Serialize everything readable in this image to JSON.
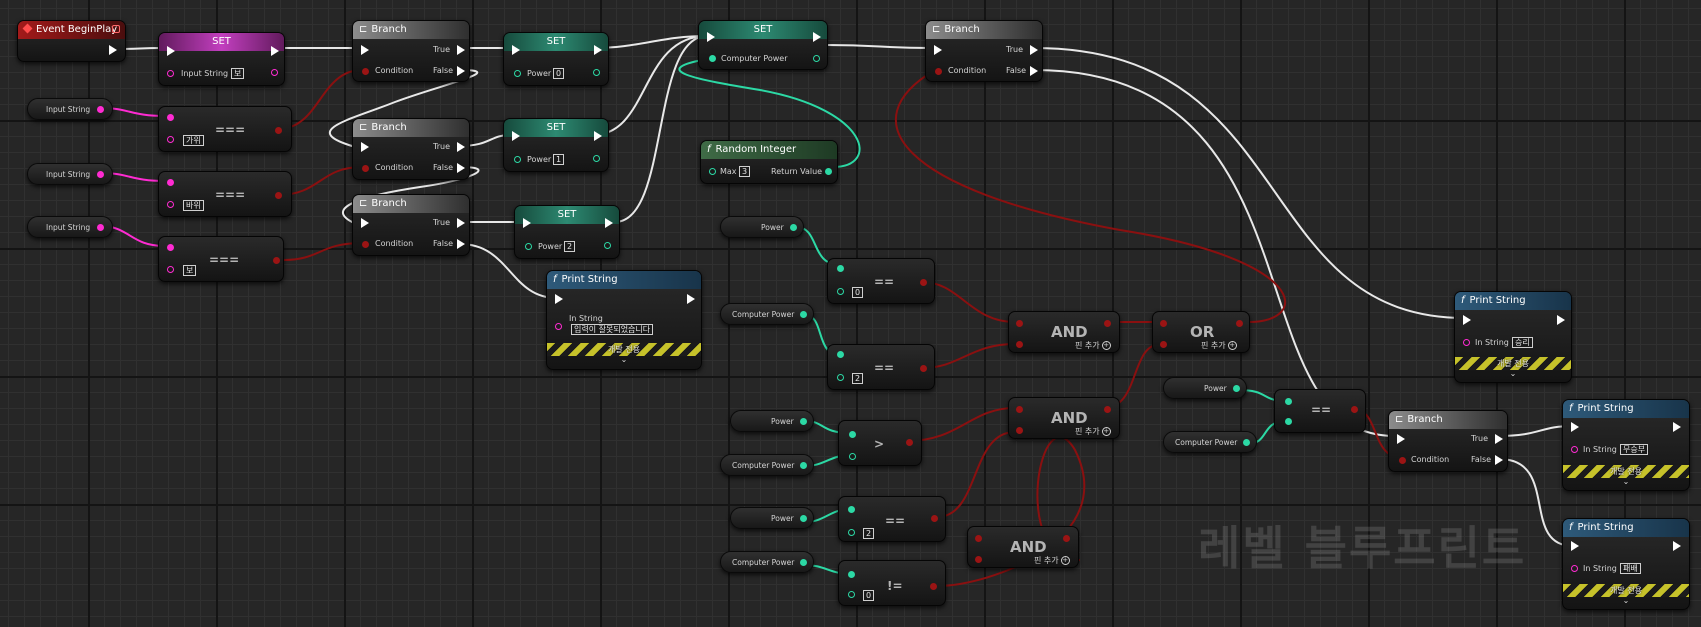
{
  "event": {
    "title": "Event BeginPlay"
  },
  "set_input": {
    "title": "SET",
    "label": "Input String",
    "value": "보"
  },
  "branch_labels": {
    "title": "Branch",
    "true": "True",
    "false": "False",
    "condition": "Condition"
  },
  "var_input_string": "Input String",
  "var_power": "Power",
  "var_computer_power": "Computer Power",
  "eq_strings": [
    {
      "value": "가위",
      "op": "==="
    },
    {
      "value": "바위",
      "op": "==="
    },
    {
      "value": "보",
      "op": "==="
    }
  ],
  "set_power": [
    {
      "title": "SET",
      "label": "Power",
      "value": "0"
    },
    {
      "title": "SET",
      "label": "Power",
      "value": "1"
    },
    {
      "title": "SET",
      "label": "Power",
      "value": "2"
    }
  ],
  "set_computer": {
    "title": "SET",
    "label": "Computer Power"
  },
  "random_integer": {
    "title": "Random Integer",
    "max_label": "Max",
    "max_value": "3",
    "return_label": "Return Value"
  },
  "print_strings": [
    {
      "title": "Print String",
      "label": "In String",
      "value": "입력이 잘못되었습니다",
      "dev": "개발 전용",
      "chevron": "⌄"
    },
    {
      "title": "Print String",
      "label": "In String",
      "value": "승리",
      "dev": "개발 전용",
      "chevron": "⌄"
    },
    {
      "title": "Print String",
      "label": "In String",
      "value": "무승부",
      "dev": "개발 전용",
      "chevron": "⌄"
    },
    {
      "title": "Print String",
      "label": "In String",
      "value": "패배",
      "dev": "개발 전용",
      "chevron": "⌄"
    }
  ],
  "compare": {
    "eq1": {
      "op": "==",
      "value": "0"
    },
    "eq2": {
      "op": "==",
      "value": "2"
    },
    "gt": {
      "op": ">"
    },
    "eq3": {
      "op": "==",
      "value": "2"
    },
    "ne": {
      "op": "!=",
      "value": "0"
    },
    "eq4": {
      "op": "=="
    }
  },
  "logic": {
    "and": "AND",
    "or": "OR",
    "add_pin": "핀 추가"
  },
  "watermark": "레벨 블루프린트",
  "colors": {
    "exec": "#ffffff",
    "string": "#ff2bd2",
    "integer": "#2cd9a5",
    "boolean": "#9b1414"
  }
}
